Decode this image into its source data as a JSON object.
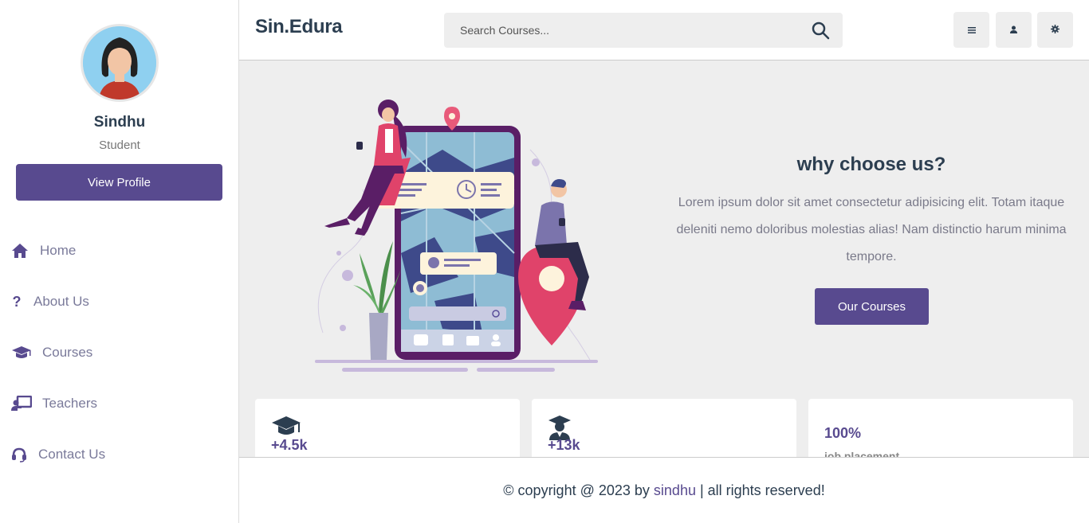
{
  "sidebar": {
    "profile": {
      "name": "Sindhu",
      "role": "Student",
      "button": "View Profile"
    },
    "items": [
      {
        "label": "Home",
        "icon": "home-icon"
      },
      {
        "label": "About Us",
        "icon": "question-icon"
      },
      {
        "label": "Courses",
        "icon": "graduation-cap-icon"
      },
      {
        "label": "Teachers",
        "icon": "teacher-icon"
      },
      {
        "label": "Contact Us",
        "icon": "headset-icon"
      }
    ]
  },
  "header": {
    "brand": "Sin.Edura",
    "search_placeholder": "Search Courses...",
    "buttons": [
      "menu-icon",
      "user-icon",
      "settings-icon"
    ]
  },
  "hero": {
    "title": "why choose us?",
    "text": "Lorem ipsum dolor sit amet consectetur adipisicing elit. Totam itaque deleniti nemo doloribus molestias alias! Nam distinctio harum minima tempore.",
    "button": "Our Courses"
  },
  "stats": [
    {
      "value": "+4.5k",
      "icon": "graduation-cap-icon"
    },
    {
      "value": "+13k",
      "icon": "graduate-student-icon"
    },
    {
      "value": "100%",
      "subtitle": "job placement"
    }
  ],
  "footer": {
    "prefix": "© copyright @ 2023 by ",
    "owner": "sindhu",
    "suffix": " | all rights reserved!"
  },
  "colors": {
    "accent": "#584a8f",
    "text_dark": "#2c3e50",
    "background": "#eeeeee"
  }
}
